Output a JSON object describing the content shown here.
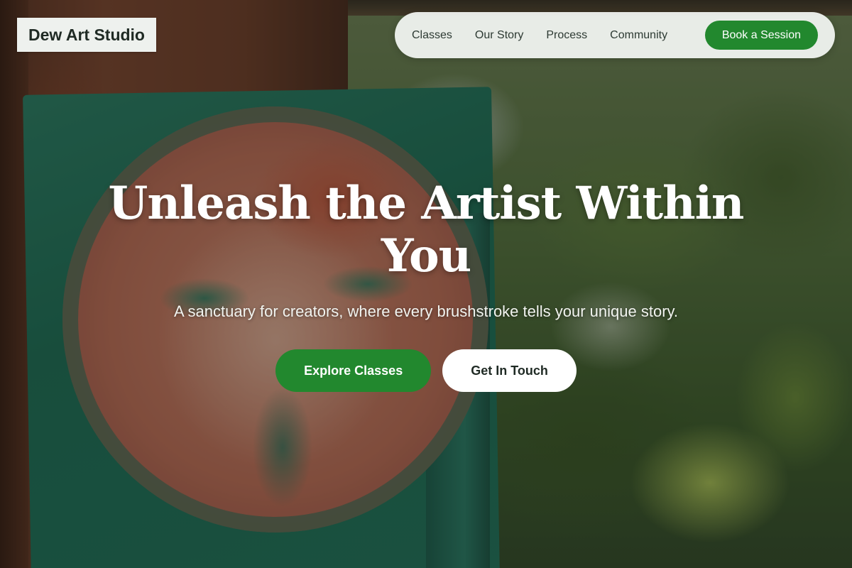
{
  "brand": {
    "name": "Dew Art Studio"
  },
  "nav": {
    "links": [
      "Classes",
      "Our Story",
      "Process",
      "Community"
    ],
    "cta_label": "Book a Session"
  },
  "hero": {
    "title": "Unleash the Artist Within You",
    "subtitle": "A sanctuary for creators, where every brushstroke tells your unique story.",
    "primary_label": "Explore Classes",
    "secondary_label": "Get In Touch"
  },
  "colors": {
    "accent_green": "#22882e",
    "nav_background": "#f4f8f4",
    "brand_background": "#eef1ee"
  }
}
